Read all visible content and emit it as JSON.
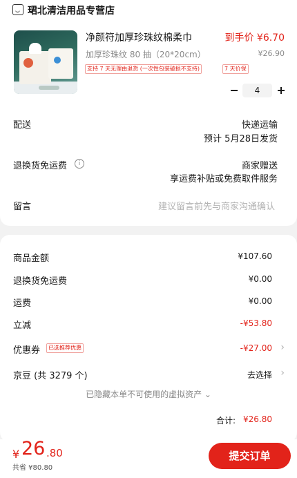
{
  "store": {
    "name": "珺北清洁用品专营店",
    "icon": "store-icon"
  },
  "product": {
    "title": "净颜符加厚珍珠纹棉柔巾",
    "final_price": "到手价 ¥6.70",
    "spec": "加厚珍珠纹 80 抽（20*20cm）",
    "original_price": "¥26.90",
    "tags": [
      "支持 7 天无理由退货 (一次性包装破损不支持)",
      "7 天价保"
    ],
    "quantity": "4"
  },
  "delivery": {
    "label": "配送",
    "method": "快递运输",
    "eta": "预计 5月28日发货"
  },
  "return_shipping": {
    "label": "退换货免运费",
    "value_line1": "商家赠送",
    "value_line2": "享运费补贴或免费取件服务"
  },
  "note": {
    "label": "留言",
    "placeholder": "建议留言前先与商家沟通确认"
  },
  "summary": {
    "goods_amount": {
      "label": "商品金额",
      "value": "¥107.60"
    },
    "return_free": {
      "label": "退换货免运费",
      "value": "¥0.00"
    },
    "shipping": {
      "label": "运费",
      "value": "¥0.00"
    },
    "instant_discount": {
      "label": "立减",
      "value": "-¥53.80"
    },
    "coupon": {
      "label": "优惠券",
      "tag": "已选推荐优惠",
      "value": "-¥27.00"
    },
    "jingdou": {
      "label": "京豆 (共 3279 个)",
      "value": "去选择"
    },
    "hidden_note": "已隐藏本单不可使用的虚拟资产 ⌄",
    "subtotal_label": "合计:",
    "subtotal_value": "¥26.80"
  },
  "bottom_bar": {
    "currency": "¥",
    "total_integer": "26",
    "total_decimal": ".80",
    "saved": "共省 ¥80.80",
    "submit_label": "提交订单"
  },
  "colors": {
    "accent": "#e2231a",
    "background": "#f2f2f2"
  }
}
